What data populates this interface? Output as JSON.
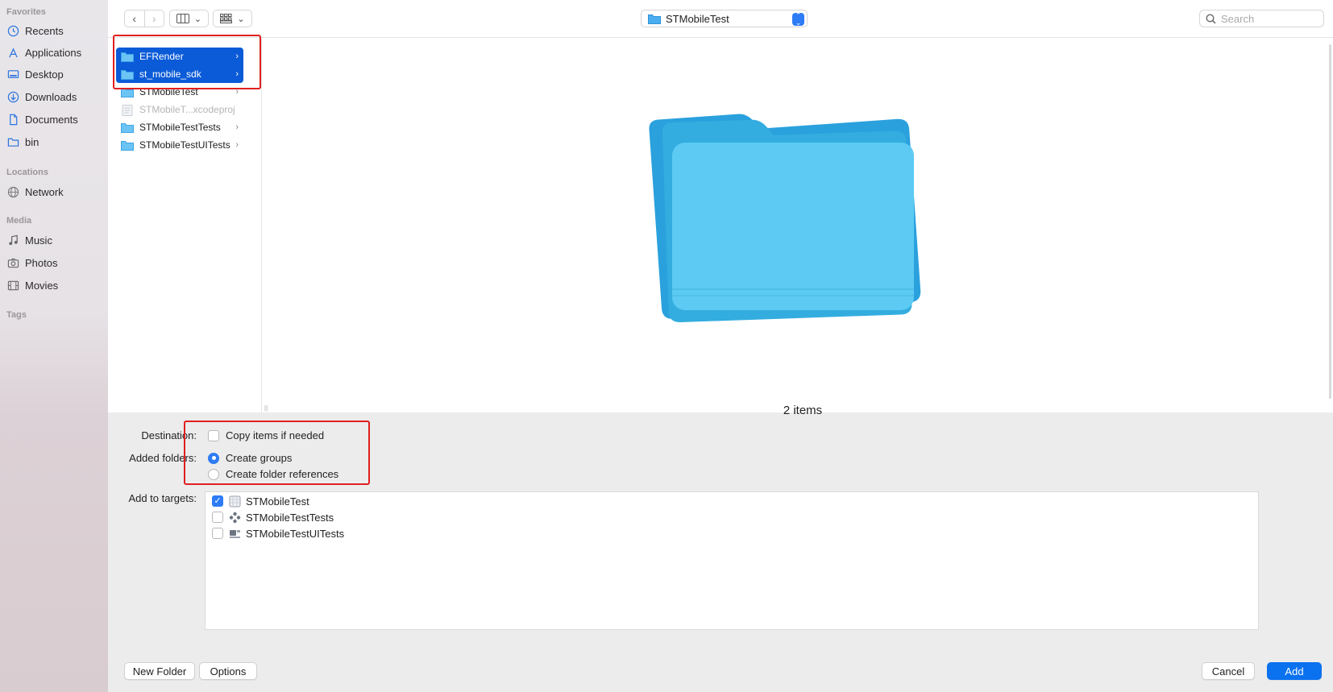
{
  "sidebar": {
    "sections": [
      {
        "label": "Favorites"
      },
      {
        "label": "Locations"
      },
      {
        "label": "Media"
      },
      {
        "label": "Tags"
      }
    ],
    "items": [
      {
        "label": "Recents",
        "icon": "clock-icon"
      },
      {
        "label": "Applications",
        "icon": "applications-icon"
      },
      {
        "label": "Desktop",
        "icon": "desktop-icon"
      },
      {
        "label": "Downloads",
        "icon": "downloads-icon"
      },
      {
        "label": "Documents",
        "icon": "document-icon"
      },
      {
        "label": "bin",
        "icon": "folder-icon"
      },
      {
        "label": "Network",
        "icon": "globe-icon"
      },
      {
        "label": "Music",
        "icon": "music-icon"
      },
      {
        "label": "Photos",
        "icon": "camera-icon"
      },
      {
        "label": "Movies",
        "icon": "film-icon"
      }
    ]
  },
  "toolbar": {
    "path_label": "STMobileTest",
    "search_placeholder": "Search"
  },
  "browser": {
    "files": [
      {
        "name": "EFRender",
        "selected": true,
        "has_children": true
      },
      {
        "name": "st_mobile_sdk",
        "selected": true,
        "has_children": true
      },
      {
        "name": "STMobileTest",
        "selected": false,
        "has_children": true
      },
      {
        "name": "STMobileT...xcodeproj",
        "selected": false,
        "has_children": false,
        "dimmed": true
      },
      {
        "name": "STMobileTestTests",
        "selected": false,
        "has_children": true
      },
      {
        "name": "STMobileTestUITests",
        "selected": false,
        "has_children": true
      }
    ],
    "preview_caption": "2 items"
  },
  "options": {
    "destination_label": "Destination:",
    "copy_items_label": "Copy items if needed",
    "copy_items_checked": false,
    "added_folders_label": "Added folders:",
    "create_groups_label": "Create groups",
    "create_folder_refs_label": "Create folder references",
    "selected_folder_option": "Create groups",
    "add_to_targets_label": "Add to targets:",
    "targets": [
      {
        "name": "STMobileTest",
        "checked": true,
        "icon": "app-target-icon"
      },
      {
        "name": "STMobileTestTests",
        "checked": false,
        "icon": "unit-test-target-icon"
      },
      {
        "name": "STMobileTestUITests",
        "checked": false,
        "icon": "ui-test-target-icon"
      }
    ]
  },
  "footer": {
    "new_folder_label": "New Folder",
    "options_label": "Options",
    "cancel_label": "Cancel",
    "add_label": "Add"
  },
  "colors": {
    "accent": "#0a71ef",
    "selection": "#0b5bd8",
    "annotation": "#e02020",
    "folder": "#5ac8fa"
  }
}
